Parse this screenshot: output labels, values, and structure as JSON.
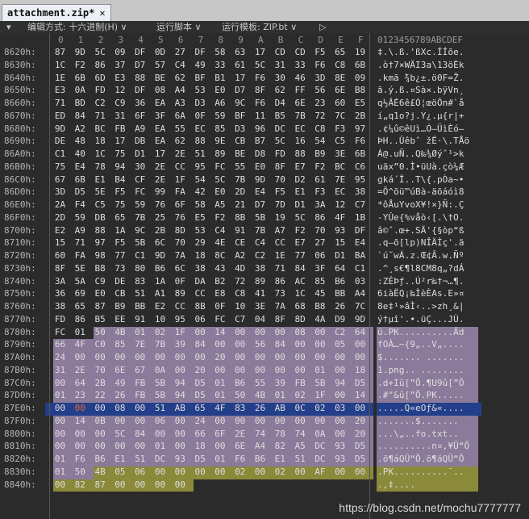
{
  "tab": {
    "title": "attachment.zip*",
    "close": "✕"
  },
  "toolbar": {
    "menu_arrow": "▾",
    "edit_mode": "编辑方式: 十六进制(H) ∨",
    "run_script": "运行脚本 ∨",
    "run_template": "运行模板: ZIP.bt ∨",
    "play": "▷"
  },
  "columns": [
    "0",
    "1",
    "2",
    "3",
    "4",
    "5",
    "6",
    "7",
    "8",
    "9",
    "A",
    "B",
    "C",
    "D",
    "E",
    "F"
  ],
  "text_header": "0123456789ABCDEF",
  "rows": [
    {
      "addr": "8620h:",
      "hex": [
        "87",
        "9D",
        "5C",
        "09",
        "DF",
        "0D",
        "27",
        "DF",
        "58",
        "63",
        "17",
        "CD",
        "CD",
        "F5",
        "65",
        "19"
      ],
      "text": "‡.\\.ß.'ßXc.ÍÍõe."
    },
    {
      "addr": "8630h:",
      "hex": [
        "1C",
        "F2",
        "86",
        "37",
        "D7",
        "57",
        "C4",
        "49",
        "33",
        "61",
        "5C",
        "31",
        "33",
        "F6",
        "C8",
        "6B"
      ],
      "text": ".ò†7×WÄI3a\\13öÈk"
    },
    {
      "addr": "8640h:",
      "hex": [
        "1E",
        "6B",
        "6D",
        "E3",
        "88",
        "BE",
        "62",
        "BF",
        "B1",
        "17",
        "F6",
        "30",
        "46",
        "3D",
        "8E",
        "09"
      ],
      "text": ".kmã ̈¾b¿±.ö0F=Ž."
    },
    {
      "addr": "8650h:",
      "hex": [
        "E3",
        "0A",
        "FD",
        "12",
        "DF",
        "08",
        "A4",
        "53",
        "E0",
        "D7",
        "8F",
        "62",
        "FF",
        "56",
        "6E",
        "B8"
      ],
      "text": "ã.ý.ß.¤Sà×.bÿVn¸"
    },
    {
      "addr": "8660h:",
      "hex": [
        "71",
        "BD",
        "C2",
        "C9",
        "36",
        "EA",
        "A3",
        "D3",
        "A6",
        "9C",
        "F6",
        "D4",
        "6E",
        "23",
        "60",
        "E5"
      ],
      "text": "q½ÂÉ6ê£Ó¦œöÔn#`å"
    },
    {
      "addr": "8670h:",
      "hex": [
        "ED",
        "84",
        "71",
        "31",
        "6F",
        "3F",
        "6A",
        "0F",
        "59",
        "BF",
        "11",
        "B5",
        "7B",
        "72",
        "7C",
        "2B"
      ],
      "text": "í„q1o?j.Y¿.µ{r|+"
    },
    {
      "addr": "8680h:",
      "hex": [
        "9D",
        "A2",
        "BC",
        "FB",
        "A9",
        "EA",
        "55",
        "EC",
        "85",
        "D3",
        "96",
        "DC",
        "EC",
        "C8",
        "F3",
        "97"
      ],
      "text": ".¢¼û©êUì…Ó–ÜìÈó—"
    },
    {
      "addr": "8690h:",
      "hex": [
        "DE",
        "48",
        "18",
        "17",
        "DB",
        "EA",
        "62",
        "88",
        "9E",
        "CB",
        "B7",
        "5C",
        "16",
        "54",
        "C5",
        "F6"
      ],
      "text": "ÞH..Ûêbˆ žË·\\.TÅö"
    },
    {
      "addr": "86A0h:",
      "hex": [
        "C1",
        "40",
        "1C",
        "75",
        "D1",
        "17",
        "2E",
        "51",
        "89",
        "BE",
        "D8",
        "FD",
        "88",
        "B9",
        "3E",
        "6B"
      ],
      "text": "Á@.uÑ..Q‰¾Øýˆ¹>k"
    },
    {
      "addr": "86B0h:",
      "hex": [
        "75",
        "E4",
        "78",
        "94",
        "30",
        "2E",
        "CC",
        "95",
        "FC",
        "55",
        "E0",
        "8F",
        "E7",
        "F2",
        "BC",
        "C6"
      ],
      "text": "uäx”0.Ì•üUà.çò¼Æ"
    },
    {
      "addr": "86C0h:",
      "hex": [
        "67",
        "6B",
        "E1",
        "B4",
        "CF",
        "2E",
        "1F",
        "54",
        "5C",
        "7B",
        "9D",
        "70",
        "D2",
        "61",
        "7E",
        "95"
      ],
      "text": "gká´Ï..T\\{.pÒa~•"
    },
    {
      "addr": "86D0h:",
      "hex": [
        "3D",
        "D5",
        "5E",
        "F5",
        "FC",
        "99",
        "FA",
        "42",
        "E0",
        "2D",
        "E4",
        "F5",
        "E1",
        "F3",
        "EC",
        "38"
      ],
      "text": "=Õ^õü™úBà-äõáóì8"
    },
    {
      "addr": "86E0h:",
      "hex": [
        "2A",
        "F4",
        "C5",
        "75",
        "59",
        "76",
        "6F",
        "58",
        "A5",
        "21",
        "D7",
        "7D",
        "D1",
        "3A",
        "12",
        "C7"
      ],
      "text": "*ôÅuYvoX¥!×}Ñ:.Ç"
    },
    {
      "addr": "86F0h:",
      "hex": [
        "2D",
        "59",
        "DB",
        "65",
        "7B",
        "25",
        "76",
        "E5",
        "F2",
        "8B",
        "5B",
        "19",
        "5C",
        "86",
        "4F",
        "1B"
      ],
      "text": "-YÛe{%våò‹[.\\†O."
    },
    {
      "addr": "8700h:",
      "hex": [
        "E2",
        "A9",
        "88",
        "1A",
        "9C",
        "2B",
        "8D",
        "53",
        "C4",
        "91",
        "7B",
        "A7",
        "F2",
        "70",
        "93",
        "DF"
      ],
      "text": "â©ˆ.œ+.SÄ'{§òp“ß"
    },
    {
      "addr": "8710h:",
      "hex": [
        "15",
        "71",
        "97",
        "F5",
        "5B",
        "6C",
        "70",
        "29",
        "4E",
        "CE",
        "C4",
        "CC",
        "E7",
        "27",
        "15",
        "E4"
      ],
      "text": ".q—õ[lp)NÎÄÌç'.ä"
    },
    {
      "addr": "8720h:",
      "hex": [
        "60",
        "FA",
        "98",
        "77",
        "C1",
        "9D",
        "7A",
        "18",
        "8C",
        "A2",
        "C2",
        "1E",
        "77",
        "06",
        "D1",
        "BA"
      ],
      "text": "`ú˜wÁ.z.Œ¢Â.w.Ñº"
    },
    {
      "addr": "8730h:",
      "hex": [
        "8F",
        "5E",
        "B8",
        "73",
        "80",
        "B6",
        "6C",
        "38",
        "43",
        "4D",
        "38",
        "71",
        "84",
        "3F",
        "64",
        "C1"
      ],
      "text": ".^¸s€¶l8CM8q„?dÁ"
    },
    {
      "addr": "8740h:",
      "hex": [
        "3A",
        "5A",
        "C9",
        "DE",
        "83",
        "1A",
        "0F",
        "DA",
        "B2",
        "72",
        "89",
        "86",
        "AC",
        "85",
        "B6",
        "03"
      ],
      "text": ":ZÉÞƒ..Ú²r‰†¬…¶."
    },
    {
      "addr": "8750h:",
      "hex": [
        "36",
        "69",
        "E0",
        "CB",
        "51",
        "A1",
        "89",
        "CC",
        "E8",
        "C8",
        "41",
        "73",
        "1C",
        "45",
        "BB",
        "A4"
      ],
      "text": "6iàËQ¡‰ÌèÈAs.E»¤"
    },
    {
      "addr": "8760h:",
      "hex": [
        "38",
        "65",
        "87",
        "B9",
        "BB",
        "E2",
        "CC",
        "8B",
        "0F",
        "10",
        "3E",
        "7A",
        "68",
        "B8",
        "26",
        "7C"
      ],
      "text": "8e‡¹»âÌ‹..>zh¸&|"
    },
    {
      "addr": "8770h:",
      "hex": [
        "FD",
        "86",
        "B5",
        "EE",
        "91",
        "10",
        "95",
        "06",
        "FC",
        "C7",
        "04",
        "8F",
        "8D",
        "4A",
        "D9",
        "9D"
      ],
      "text": "ý†µî'.•.üÇ...JÙ."
    },
    {
      "addr": "8780h:",
      "hex": [
        "FC",
        "01",
        "50",
        "4B",
        "01",
        "02",
        "1F",
        "00",
        "14",
        "00",
        "00",
        "00",
        "08",
        "00",
        "C2",
        "64"
      ],
      "text": "ü.PK..........Âd"
    },
    {
      "addr": "8790h:",
      "hex": [
        "66",
        "4F",
        "C0",
        "85",
        "7E",
        "7B",
        "39",
        "84",
        "00",
        "00",
        "56",
        "84",
        "00",
        "00",
        "05",
        "00"
      ],
      "text": "fOÀ…~{9„..V„...."
    },
    {
      "addr": "87A0h:",
      "hex": [
        "24",
        "00",
        "00",
        "00",
        "00",
        "00",
        "00",
        "00",
        "20",
        "00",
        "00",
        "00",
        "00",
        "00",
        "00",
        "00"
      ],
      "text": "$....... ......."
    },
    {
      "addr": "87B0h:",
      "hex": [
        "31",
        "2E",
        "70",
        "6E",
        "67",
        "0A",
        "00",
        "20",
        "00",
        "00",
        "00",
        "00",
        "00",
        "01",
        "00",
        "18"
      ],
      "text": "1.png.. ........"
    },
    {
      "addr": "87C0h:",
      "hex": [
        "00",
        "64",
        "2B",
        "49",
        "FB",
        "5B",
        "94",
        "D5",
        "01",
        "B6",
        "55",
        "39",
        "FB",
        "5B",
        "94",
        "D5"
      ],
      "text": ".d+Iû[”Õ.¶U9û[”Õ"
    },
    {
      "addr": "87D0h:",
      "hex": [
        "01",
        "23",
        "22",
        "26",
        "FB",
        "5B",
        "94",
        "D5",
        "01",
        "50",
        "4B",
        "01",
        "02",
        "1F",
        "00",
        "14"
      ],
      "text": ".#\"&û[”Õ.PK....."
    },
    {
      "addr": "87E0h:",
      "hex": [
        "00",
        "00",
        "00",
        "08",
        "00",
        "51",
        "AB",
        "65",
        "4F",
        "83",
        "26",
        "AB",
        "0C",
        "02",
        "03",
        "00"
      ],
      "text": ".....Q«eOƒ&«...."
    },
    {
      "addr": "87F0h:",
      "hex": [
        "00",
        "14",
        "0B",
        "00",
        "00",
        "06",
        "00",
        "24",
        "00",
        "00",
        "00",
        "00",
        "00",
        "00",
        "00",
        "20"
      ],
      "text": ".......$....... "
    },
    {
      "addr": "8800h:",
      "hex": [
        "00",
        "00",
        "00",
        "5C",
        "84",
        "00",
        "00",
        "66",
        "6F",
        "2E",
        "74",
        "78",
        "74",
        "0A",
        "00",
        "20"
      ],
      "text": "...\\„..fo.txt.. "
    },
    {
      "addr": "8810h:",
      "hex": [
        "00",
        "00",
        "00",
        "00",
        "00",
        "01",
        "00",
        "18",
        "00",
        "6E",
        "A4",
        "82",
        "A5",
        "DC",
        "93",
        "D5"
      ],
      "text": "..........n¤‚¥Ü“Õ"
    },
    {
      "addr": "8820h:",
      "hex": [
        "01",
        "F6",
        "B6",
        "E1",
        "51",
        "DC",
        "93",
        "D5",
        "01",
        "F6",
        "B6",
        "E1",
        "51",
        "DC",
        "93",
        "D5"
      ],
      "text": ".ö¶áQÜ“Õ.ö¶áQÜ“Õ"
    },
    {
      "addr": "8830h:",
      "hex": [
        "01",
        "50",
        "4B",
        "05",
        "06",
        "00",
        "00",
        "00",
        "00",
        "02",
        "00",
        "02",
        "00",
        "AF",
        "00",
        "00"
      ],
      "text": ".PK..........¯.."
    },
    {
      "addr": "8840h:",
      "hex": [
        "00",
        "82",
        "87",
        "00",
        "00",
        "00",
        "00",
        "",
        "",
        "",
        "",
        "",
        "",
        "",
        "",
        ""
      ],
      "text": ".‚‡...."
    }
  ],
  "highlight_colors": {
    "purple": "#8b7a9a",
    "olive": "#8a8a3a",
    "blue": "#243f8a",
    "red_text": "#e06a3a"
  },
  "watermark": "https://blog.csdn.net/mochu7777777"
}
